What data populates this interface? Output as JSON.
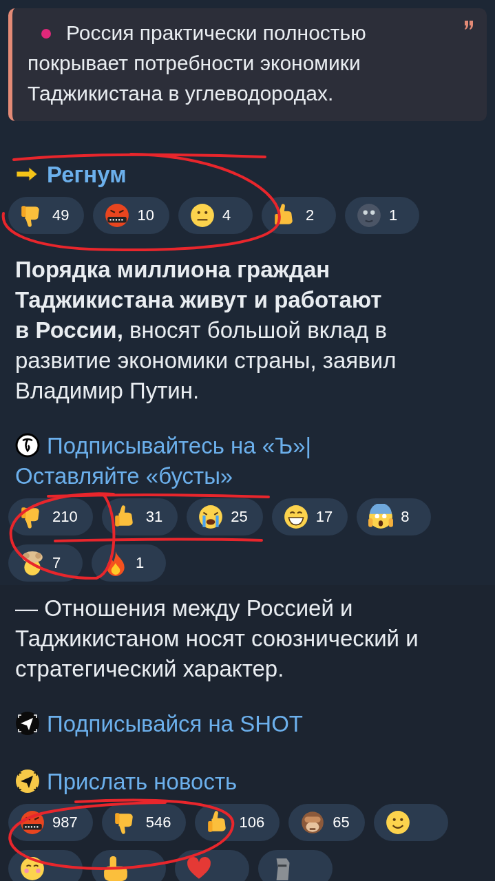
{
  "sections": [
    {
      "blocks": [
        {
          "kind": "quote",
          "text": "Россия практически полностью покрывает потребности экономики Таджикистана в углеводородах."
        },
        {
          "kind": "link",
          "icon": {
            "kind": "arrow"
          },
          "text": "Регнум",
          "bold": true
        },
        {
          "kind": "reactions",
          "items": [
            {
              "kind": "thumbsdown",
              "count": "49"
            },
            {
              "kind": "cursing",
              "count": "10"
            },
            {
              "kind": "neutral",
              "count": "4"
            },
            {
              "kind": "thumbsup",
              "count": "2"
            },
            {
              "kind": "moon",
              "count": "1"
            }
          ]
        },
        {
          "kind": "text",
          "text": "**Порядка миллиона граждан Таджикистана живут и работают в России,** вносят большой вклад в развитие экономики страны, заявил Владимир Путин."
        },
        {
          "kind": "link",
          "icon": {
            "kind": "logo"
          },
          "text": "Подписывайтесь на «Ъ»| Оставляйте «бусты»",
          "bold": false
        },
        {
          "kind": "reactions",
          "items": [
            {
              "kind": "thumbsdown",
              "count": "210"
            },
            {
              "kind": "thumbsup",
              "count": "31"
            },
            {
              "kind": "crying",
              "count": "25"
            },
            {
              "kind": "grin",
              "count": "17"
            },
            {
              "kind": "scream",
              "count": "8"
            },
            {
              "kind": "exploding",
              "count": "7"
            },
            {
              "kind": "fire",
              "count": "1"
            }
          ]
        }
      ]
    },
    {
      "blocks": [
        {
          "kind": "text",
          "text": "— Отношения между Россией и Таджикистаном носят союзнический и стратегический характер."
        },
        {
          "kind": "link",
          "icon": {
            "kind": "plane_dark"
          },
          "text": "Подписывайся на SHOT",
          "bold": false
        },
        {
          "kind": "link",
          "icon": {
            "kind": "plane_yellow"
          },
          "text": "Прислать новость",
          "bold": false
        },
        {
          "kind": "reactions",
          "items": [
            {
              "kind": "cursing",
              "count": "987"
            },
            {
              "kind": "thumbsdown",
              "count": "546"
            },
            {
              "kind": "thumbsup",
              "count": "106"
            },
            {
              "kind": "monkey",
              "count": "65"
            },
            {
              "kind": "smile"
            },
            {
              "kind": "blush"
            },
            {
              "kind": "pointup"
            },
            {
              "kind": "heart"
            },
            {
              "kind": "moai"
            }
          ]
        }
      ]
    }
  ]
}
